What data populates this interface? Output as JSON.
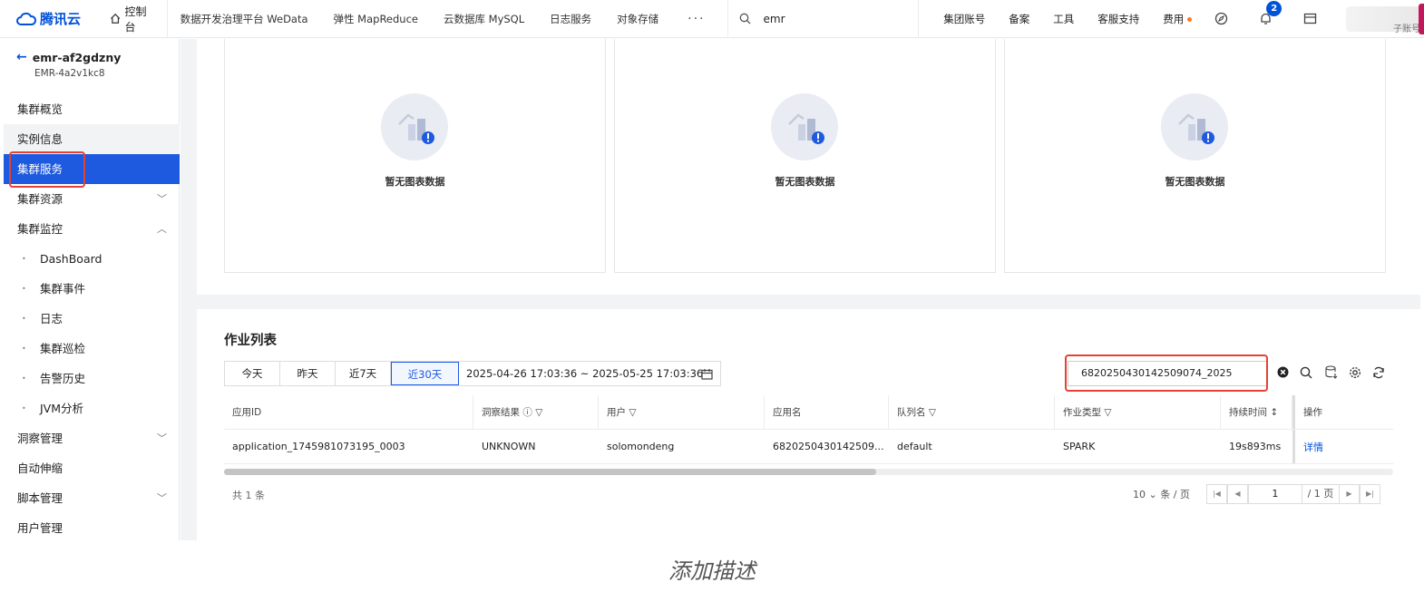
{
  "topnav": {
    "logo": "腾讯云",
    "console": "控制台",
    "links": [
      "数据开发治理平台 WeData",
      "弹性 MapReduce",
      "云数据库 MySQL",
      "日志服务",
      "对象存储"
    ],
    "more": "···",
    "search_value": "emr",
    "right_links": [
      "集团账号",
      "备案",
      "工具",
      "客服支持"
    ],
    "billing": "费用",
    "notification_count": "2",
    "account_label": "子账号"
  },
  "sidebar": {
    "cluster_name": "emr-af2gdzny",
    "cluster_id": "EMR-4a2v1kc8",
    "items": [
      {
        "label": "集群概览"
      },
      {
        "label": "实例信息"
      },
      {
        "label": "集群服务"
      },
      {
        "label": "集群资源"
      },
      {
        "label": "集群监控"
      },
      {
        "label": "DashBoard"
      },
      {
        "label": "集群事件"
      },
      {
        "label": "日志"
      },
      {
        "label": "集群巡检"
      },
      {
        "label": "告警历史"
      },
      {
        "label": "JVM分析"
      },
      {
        "label": "洞察管理"
      },
      {
        "label": "自动伸缩"
      },
      {
        "label": "脚本管理"
      },
      {
        "label": "用户管理"
      }
    ]
  },
  "charts": {
    "empty_text": "暂无图表数据"
  },
  "jobs": {
    "title": "作业列表",
    "ranges": [
      "今天",
      "昨天",
      "近7天",
      "近30天"
    ],
    "date_range": "2025-04-26 17:03:36  ~ 2025-05-25 17:03:36",
    "filter_value": "6820250430142509074_2025",
    "columns": [
      "应用ID",
      "洞察结果",
      "用户",
      "应用名",
      "队列名",
      "作业类型",
      "持续时间",
      "操作"
    ],
    "rows": [
      {
        "app_id": "application_1745981073195_0003",
        "insight": "UNKNOWN",
        "user": "solomondeng",
        "app_name": "6820250430142509...",
        "queue": "default",
        "job_type": "SPARK",
        "duration": "19s893ms",
        "action": "详情"
      }
    ],
    "total": "共 1 条",
    "page_size": "10",
    "page_size_unit": "条 / 页",
    "page": "1",
    "page_total": "/ 1 页"
  },
  "caption": "添加描述"
}
